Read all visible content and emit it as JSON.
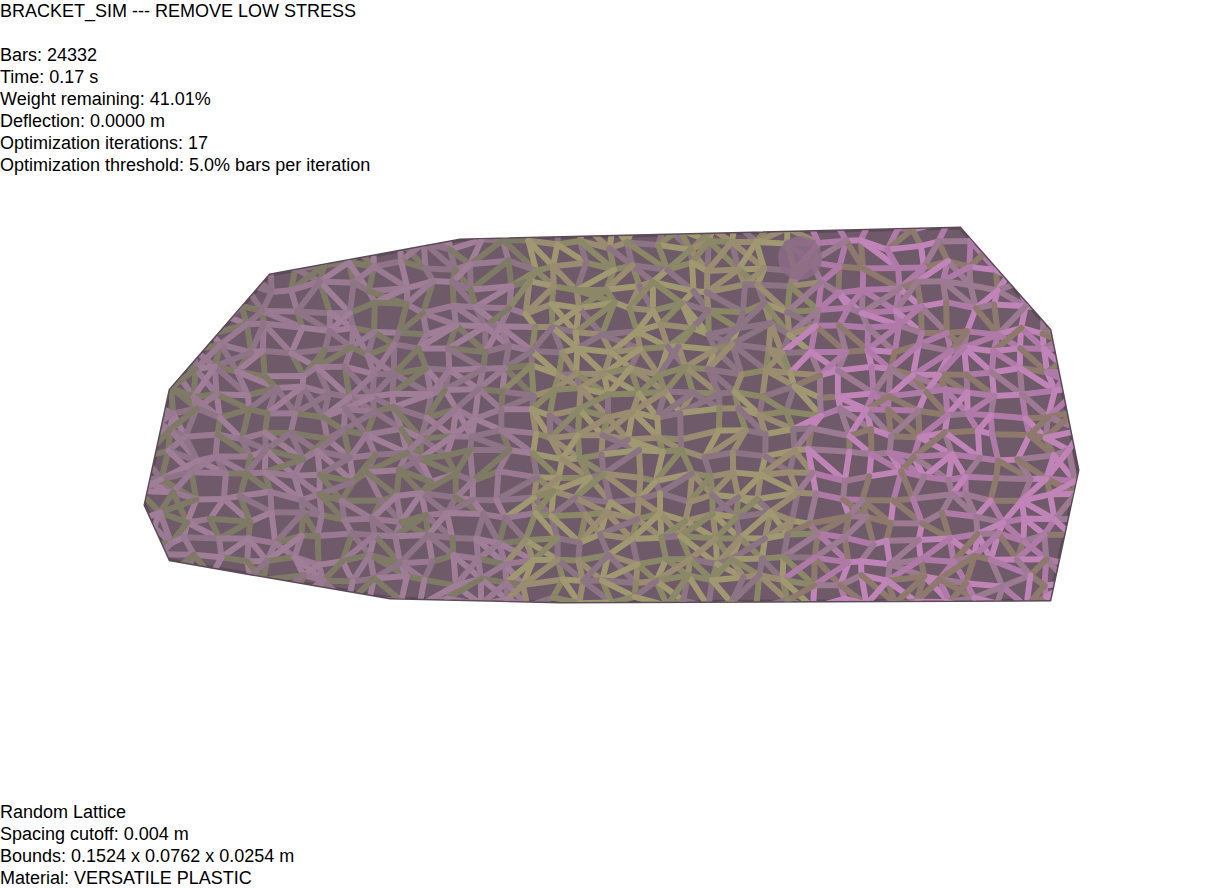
{
  "window": {
    "title": "BRACKET_SIM --- REMOVE LOW STRESS"
  },
  "stats": [
    "Bars: 24332",
    "Time: 0.17 s",
    "Weight remaining: 41.01%",
    "Deflection: 0.0000 m",
    "Optimization iterations: 17",
    "Optimization threshold: 5.0% bars per iteration"
  ],
  "footer": [
    "Random Lattice",
    "Spacing cutoff: 0.004 m",
    "Bounds: 0.1524 x 0.0762 x 0.0254 m",
    "Material: VERSATILE PLASTIC"
  ]
}
